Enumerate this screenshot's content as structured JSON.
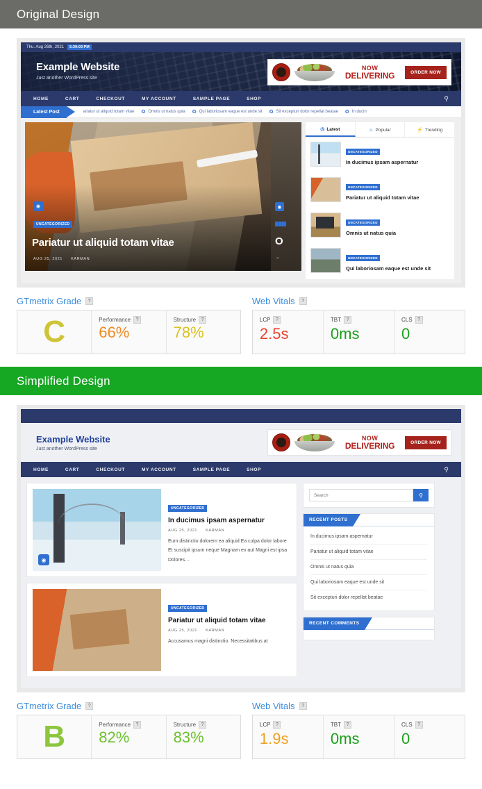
{
  "sections": {
    "original": {
      "banner_label": "Original Design",
      "banner_color": "#6b6b68"
    },
    "simplified": {
      "banner_label": "Simplified Design",
      "banner_color": "#16a723"
    }
  },
  "site": {
    "date": "Thu. Aug 26th, 2021",
    "time": "5:39:03 PM",
    "title": "Example Website",
    "tagline": "Just another WordPress site",
    "nav": [
      "HOME",
      "CART",
      "CHECKOUT",
      "MY ACCOUNT",
      "SAMPLE PAGE",
      "SHOP"
    ],
    "search_icon": "search-icon",
    "ad": {
      "headline": "NOW",
      "subhead": "DELIVERING",
      "button": "ORDER NOW"
    },
    "ticker": {
      "badge": "Latest Post",
      "items": [
        "ariatur ut aliquid totam vitae",
        "Omnis ut natus quia",
        "Qui laboriosam eaque est unde sit",
        "Sit excepturi dolor repellat beatae",
        "In ducin"
      ]
    },
    "hero": {
      "category": "UNCATEGORIZED",
      "title": "Pariatur ut aliquid totam vitae",
      "date": "AUG 25, 2021",
      "author": "KARMAN"
    },
    "sidebar_tabs": [
      {
        "label": "Latest",
        "icon": "clock-icon",
        "active": true
      },
      {
        "label": "Popular",
        "icon": "fire-icon",
        "active": false
      },
      {
        "label": "Trending",
        "icon": "bolt-icon",
        "active": false
      }
    ],
    "sidebar_posts": [
      {
        "category": "UNCATEGORIZED",
        "title": "In ducimus ipsam aspernatur"
      },
      {
        "category": "UNCATEGORIZED",
        "title": "Pariatur ut aliquid totam vitae"
      },
      {
        "category": "UNCATEGORIZED",
        "title": "Omnis ut natus quia"
      },
      {
        "category": "UNCATEGORIZED",
        "title": "Qui laboriosam eaque est unde sit"
      }
    ]
  },
  "simplified_site": {
    "posts": [
      {
        "category": "UNCATEGORIZED",
        "title": "In ducimus ipsam aspernatur",
        "date": "AUG 25, 2021",
        "author": "KARMAN",
        "excerpt": "Eum distinctio dolorem ea aliquid Ea culpa dolor labore Et suscipit ipsum neque Magnam ex aut Magni est ipsa Dolores…"
      },
      {
        "category": "UNCATEGORIZED",
        "title": "Pariatur ut aliquid totam vitae",
        "date": "AUG 25, 2021",
        "author": "KARMAN",
        "excerpt": "Accusamus magni distinctio. Necessitatibus at"
      }
    ],
    "search_placeholder": "Search",
    "widgets": [
      {
        "heading": "RECENT POSTS",
        "items": [
          "In ducimus ipsam aspernatur",
          "Pariatur ut aliquid totam vitae",
          "Omnis ut natus quia",
          "Qui laboriosam eaque est unde sit",
          "Sit excepturi dolor repellat beatae"
        ]
      },
      {
        "heading": "RECENT COMMENTS",
        "items": []
      }
    ]
  },
  "reports": {
    "original": {
      "grade_heading": "GTmetrix Grade",
      "grade": "C",
      "grade_color": "#cfc437",
      "performance_label": "Performance",
      "performance": "66%",
      "performance_color": "#ef8b22",
      "structure_label": "Structure",
      "structure": "78%",
      "structure_color": "#d9c31c",
      "vitals_heading": "Web Vitals",
      "lcp_label": "LCP",
      "lcp": "2.5s",
      "lcp_color": "#e8432f",
      "tbt_label": "TBT",
      "tbt": "0ms",
      "tbt_color": "#19a019",
      "cls_label": "CLS",
      "cls": "0",
      "cls_color": "#19a019"
    },
    "simplified": {
      "grade_heading": "GTmetrix Grade",
      "grade": "B",
      "grade_color": "#86c martin",
      "grade_color_hex": "#8cc63e",
      "performance_label": "Performance",
      "performance": "82%",
      "performance_color": "#6cc02c",
      "structure_label": "Structure",
      "structure": "83%",
      "structure_color": "#6cc02c",
      "vitals_heading": "Web Vitals",
      "lcp_label": "LCP",
      "lcp": "1.9s",
      "lcp_color": "#f0a020",
      "tbt_label": "TBT",
      "tbt": "0ms",
      "tbt_color": "#19a019",
      "cls_label": "CLS",
      "cls": "0",
      "cls_color": "#19a019"
    }
  },
  "icons": {
    "help": "?",
    "search": "⌕",
    "camera": "⌾",
    "clock": "◷",
    "fire": "♨",
    "bolt": "⚡",
    "user": "◉",
    "dot": "✪"
  }
}
